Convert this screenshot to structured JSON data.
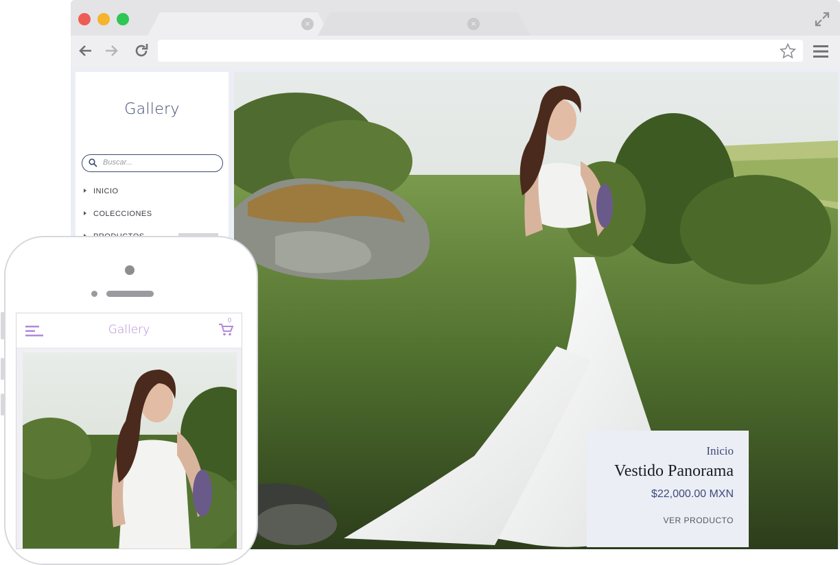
{
  "browser": {
    "address": "",
    "colors": {
      "close": "#ee5d55",
      "minimize": "#f4b42c",
      "maximize": "#2fc653"
    },
    "icons": [
      "back-arrow-icon",
      "forward-arrow-icon",
      "reload-icon",
      "star-icon",
      "menu-icon",
      "expand-icon",
      "tab-close-icon"
    ]
  },
  "sidebar": {
    "title": "Gallery",
    "search_placeholder": "Buscar...",
    "items": [
      {
        "label": "INICIO"
      },
      {
        "label": "COLECCIONES"
      },
      {
        "label": "PRODUCTOS"
      }
    ]
  },
  "hero_card": {
    "breadcrumb": "Inicio",
    "title": "Vestido Panorama",
    "price": "$22,000.00 MXN",
    "cta": "VER PRODUCTO"
  },
  "mobile": {
    "title": "Gallery",
    "cart_count": "0",
    "accent": "#b18ad6"
  }
}
